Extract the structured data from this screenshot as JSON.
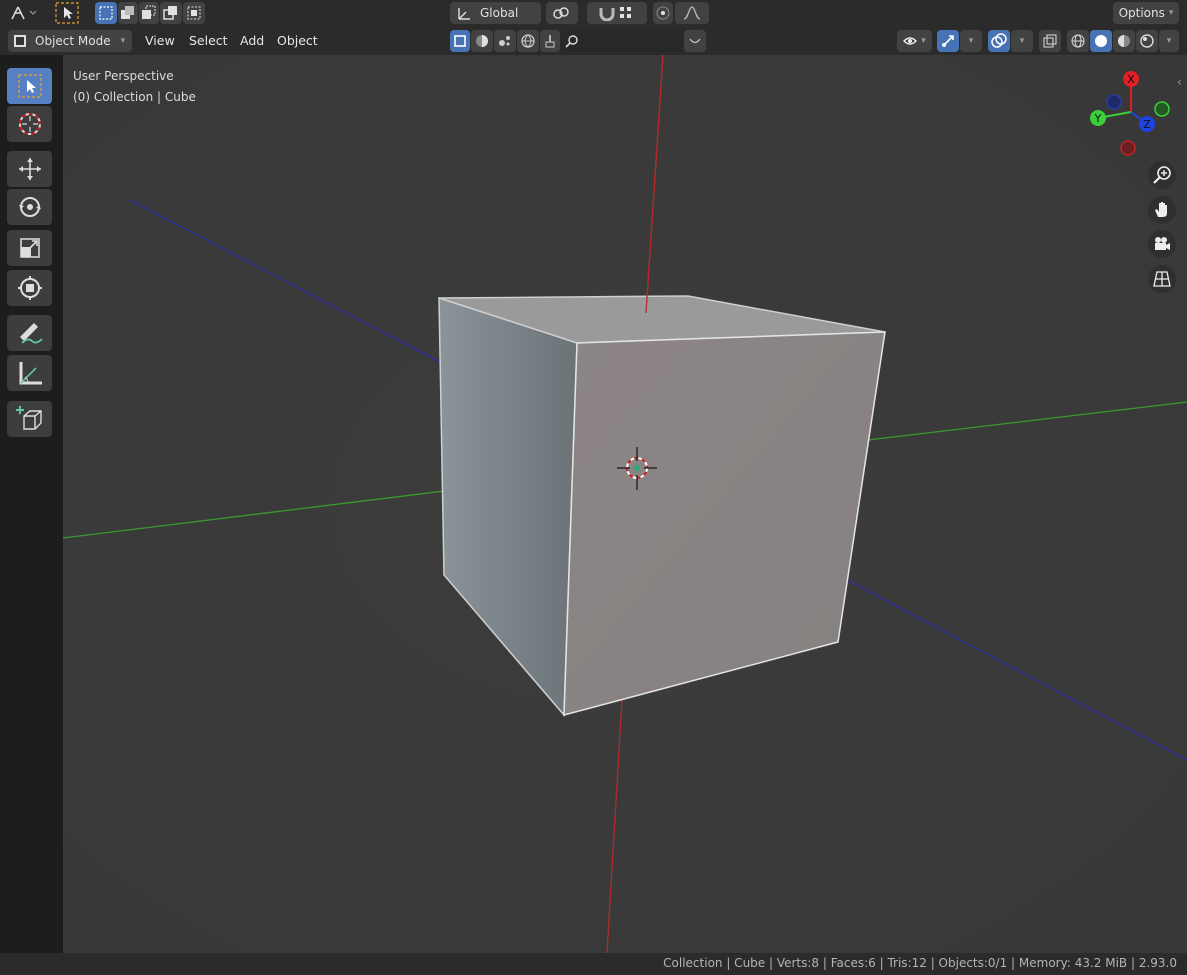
{
  "header": {
    "mode": "Object Mode",
    "menu": [
      "View",
      "Select",
      "Add",
      "Object"
    ],
    "transform_orientation": "Global",
    "options_label": "Options"
  },
  "viewport": {
    "perspective_label": "User Perspective",
    "collection_label": "(0) Collection | Cube"
  },
  "gizmo": {
    "x": "X",
    "y": "Y",
    "z": "Z",
    "colors": {
      "x": "#e21f26",
      "y": "#3ad03a",
      "z": "#1e43e2"
    }
  },
  "toolbar": {
    "tools": [
      "select-box-icon",
      "cursor-icon",
      "move-icon",
      "rotate-icon",
      "scale-icon",
      "transform-icon",
      "annotate-icon",
      "measure-icon",
      "add-cube-icon"
    ]
  },
  "statusbar": {
    "text": "Collection | Cube | Verts:8 | Faces:6 | Tris:12 | Objects:0/1 | Memory: 43.2 MiB | 2.93.0"
  },
  "colors": {
    "accent": "#4772b3",
    "background": "#393939"
  }
}
